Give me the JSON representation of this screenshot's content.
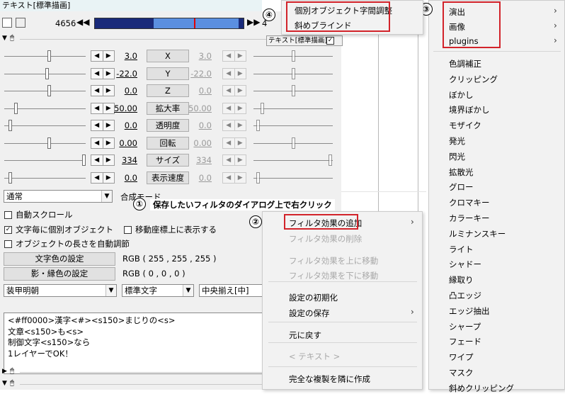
{
  "window_title": "テキスト[標準描画]",
  "toolbar": {
    "frame_count": "4656",
    "prev_label": "◀◀",
    "next_label": "▶▶",
    "next_frame": "4"
  },
  "tracks": [
    {
      "label": "X",
      "value": "3.0",
      "value2": "3.0"
    },
    {
      "label": "Y",
      "value": "-22.0",
      "value2": "-22.0"
    },
    {
      "label": "Z",
      "value": "0.0",
      "value2": "0.0"
    },
    {
      "label": "拡大率",
      "value": "50.00",
      "value2": "50.00"
    },
    {
      "label": "透明度",
      "value": "0.0",
      "value2": "0.0"
    },
    {
      "label": "回転",
      "value": "0.00",
      "value2": "0.00"
    },
    {
      "label": "サイズ",
      "value": "334",
      "value2": "334"
    },
    {
      "label": "表示速度",
      "value": "0.0",
      "value2": "0.0"
    }
  ],
  "blend": {
    "value": "通常",
    "label": "合成モード"
  },
  "options": {
    "auto_scroll": "自動スクロール",
    "per_char": "文字毎に個別オブジェクト",
    "show_on_move": "移動座標上に表示する",
    "auto_length": "オブジェクトの長さを自動調節"
  },
  "colors": {
    "text_color_btn": "文字色の設定",
    "text_color_value": "RGB ( 255 , 255 , 255 )",
    "shadow_color_btn": "影・縁色の設定",
    "shadow_color_value": "RGB ( 0 , 0 , 0 )"
  },
  "font": {
    "family": "装甲明朝",
    "style": "標準文字",
    "align": "中央揃え[中]"
  },
  "text_content": [
    "<#ff0000>漢字<#><s150>まじりの<s>",
    "文章<s150>も<s>",
    "制御文字<s150>なら",
    "1レイヤーでOK！"
  ],
  "timeline": {
    "header": "テキスト[標準描画]"
  },
  "annotations": {
    "n1": "①",
    "n2": "②",
    "n3": "③",
    "n4": "④",
    "note1": "保存したいフィルタのダイアログ上で右クリック"
  },
  "context_menu": {
    "items": [
      {
        "label": "フィルタ効果の追加",
        "has_sub": true,
        "disabled": false
      },
      {
        "label": "フィルタ効果の削除",
        "has_sub": false,
        "disabled": true
      },
      {
        "label": "フィルタ効果を上に移動",
        "has_sub": false,
        "disabled": true
      },
      {
        "label": "フィルタ効果を下に移動",
        "has_sub": false,
        "disabled": true
      },
      {
        "label": "設定の初期化",
        "has_sub": false,
        "disabled": false
      },
      {
        "label": "設定の保存",
        "has_sub": true,
        "disabled": false
      },
      {
        "label": "元に戻す",
        "has_sub": false,
        "disabled": false
      },
      {
        "label": "< テキスト >",
        "has_sub": false,
        "disabled": true
      },
      {
        "label": "完全な複製を隣に作成",
        "has_sub": false,
        "disabled": false
      }
    ]
  },
  "submenu_top": {
    "items": [
      {
        "label": "演出",
        "has_sub": true
      },
      {
        "label": "画像",
        "has_sub": true
      },
      {
        "label": "plugins",
        "has_sub": true
      }
    ],
    "filters": [
      "色調補正",
      "クリッピング",
      "ぼかし",
      "境界ぼかし",
      "モザイク",
      "発光",
      "閃光",
      "拡散光",
      "グロー",
      "クロマキー",
      "カラーキー",
      "ルミナンスキー",
      "ライト",
      "シャドー",
      "縁取り",
      "凸エッジ",
      "エッジ抽出",
      "シャープ",
      "フェード",
      "ワイプ",
      "マスク",
      "斜めクリッピング"
    ]
  },
  "submenu_plugins": {
    "items": [
      {
        "label": "個別オブジェクト字間調整"
      },
      {
        "label": "斜めブラインド"
      }
    ]
  },
  "accent_red": "#d2232a"
}
